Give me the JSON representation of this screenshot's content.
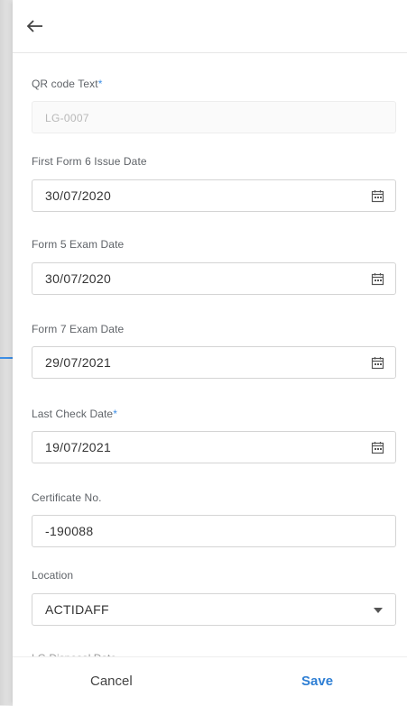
{
  "form": {
    "qr_code": {
      "label": "QR code Text",
      "required_mark": "*",
      "value": "LG-0007"
    },
    "first_form6": {
      "label": "First Form 6 Issue Date",
      "value": "30/07/2020"
    },
    "form5_exam": {
      "label": "Form 5 Exam Date",
      "value": "30/07/2020"
    },
    "form7_exam": {
      "label": "Form 7 Exam Date",
      "value": "29/07/2021"
    },
    "last_check": {
      "label": "Last Check Date",
      "required_mark": "*",
      "value": "19/07/2021"
    },
    "certificate": {
      "label": "Certificate No.",
      "value": "-190088"
    },
    "location": {
      "label": "Location",
      "value": "ACTIDAFF"
    },
    "next_field_label": "LG Disposal Date"
  },
  "footer": {
    "cancel_label": "Cancel",
    "save_label": "Save"
  },
  "icons": {
    "back": "arrow-left-icon",
    "date": "calendar-icon",
    "dropdown": "caret-down-icon",
    "pointer": "arrow-right-icon"
  },
  "colors": {
    "accent": "#2f7fd4",
    "required": "#3d8fe6",
    "pointer_arrow": "#3d8fe6"
  }
}
